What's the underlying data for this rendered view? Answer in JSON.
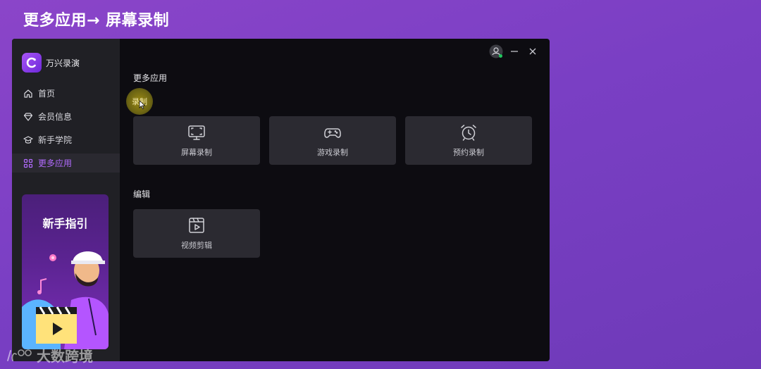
{
  "page_heading": "更多应用→ 屏幕录制",
  "app": {
    "brand_name": "万兴录演",
    "sidebar": {
      "items": [
        {
          "label": "首页",
          "icon": "home-icon"
        },
        {
          "label": "会员信息",
          "icon": "diamond-icon"
        },
        {
          "label": "新手学院",
          "icon": "graduation-cap-icon"
        },
        {
          "label": "更多应用",
          "icon": "apps-grid-icon",
          "active": true
        }
      ],
      "guide_card_title": "新手指引"
    },
    "main": {
      "section_more_apps": "更多应用",
      "recording_label": "录制",
      "record_tiles": [
        {
          "label": "屏幕录制",
          "icon": "screen-capture-icon"
        },
        {
          "label": "游戏录制",
          "icon": "gamepad-icon"
        },
        {
          "label": "预约录制",
          "icon": "alarm-clock-icon"
        }
      ],
      "section_edit": "编辑",
      "edit_tiles": [
        {
          "label": "视频剪辑",
          "icon": "video-edit-icon"
        }
      ]
    },
    "colors": {
      "accent": "#b26bff",
      "online": "#22c55e"
    }
  },
  "watermark": "大数跨境"
}
